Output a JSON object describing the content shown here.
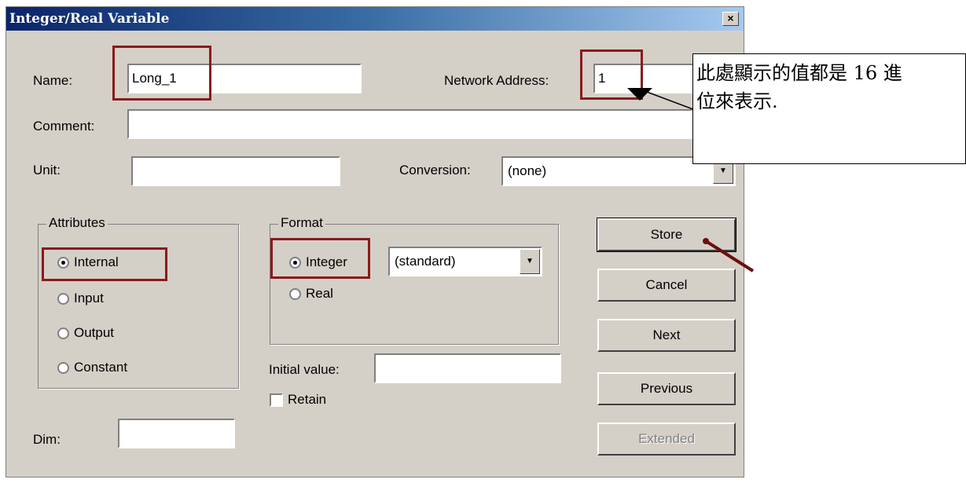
{
  "window": {
    "title": "Integer/Real Variable",
    "close": "×"
  },
  "fields": {
    "name_label": "Name:",
    "name_value": "Long_1",
    "network_label": "Network Address:",
    "network_value": "1",
    "comment_label": "Comment:",
    "comment_value": "",
    "unit_label": "Unit:",
    "unit_value": "",
    "conversion_label": "Conversion:",
    "conversion_value": "(none)",
    "initial_label": "Initial value:",
    "initial_value": "",
    "dim_label": "Dim:",
    "dim_value": ""
  },
  "attributes": {
    "title": "Attributes",
    "options": [
      "Internal",
      "Input",
      "Output",
      "Constant"
    ],
    "selected": "Internal"
  },
  "format": {
    "title": "Format",
    "options": [
      "Integer",
      "Real"
    ],
    "selected": "Integer",
    "subformat": "(standard)"
  },
  "retain": {
    "label": "Retain",
    "checked": false
  },
  "buttons": {
    "store": "Store",
    "cancel": "Cancel",
    "next": "Next",
    "previous": "Previous",
    "extended": "Extended"
  },
  "annotation": {
    "line1": "此處顯示的值都是 16 進",
    "line2": "位來表示."
  },
  "colors": {
    "highlight": "#8b1a1a",
    "titlebar": "#0a246a"
  }
}
